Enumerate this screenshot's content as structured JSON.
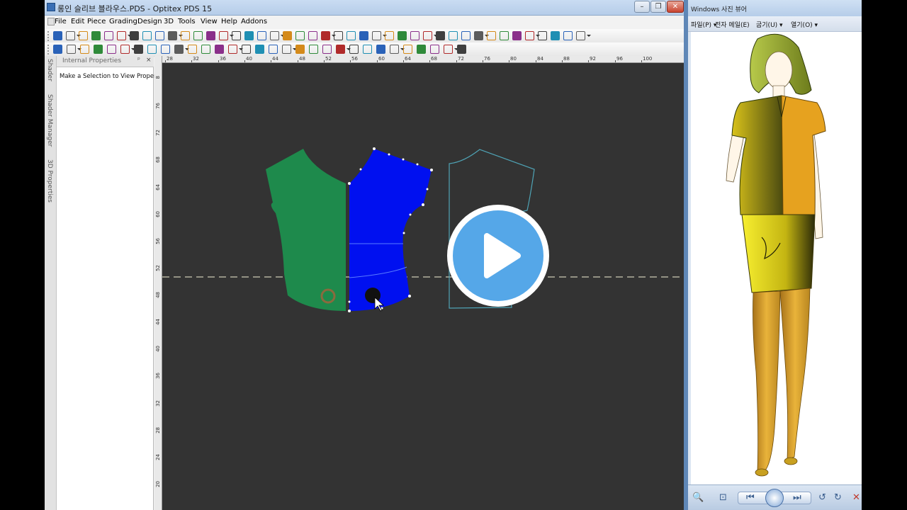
{
  "optitex": {
    "title": "롱인 슬리브 블라우스.PDS - Optitex PDS 15",
    "menu": [
      "File",
      "Edit",
      "Piece",
      "Grading",
      "Design",
      "3D",
      "Tools",
      "View",
      "Help",
      "Addons"
    ],
    "window_buttons": {
      "minimize": "–",
      "restore": "❐",
      "close": "✕"
    },
    "dock_tabs": [
      "Shader",
      "Shader Manager",
      "3D Properties"
    ],
    "panel": {
      "title": "Internal Properties",
      "pin": "ᵖ",
      "close": "×",
      "message": "Make a Selection to View Properties"
    },
    "hruler_labels": [
      "28",
      "32",
      "36",
      "40",
      "44",
      "48",
      "52",
      "56",
      "60",
      "64",
      "68",
      "72",
      "76",
      "80",
      "84",
      "88",
      "92",
      "96",
      "100"
    ],
    "vruler_labels": [
      "8",
      "76",
      "72",
      "68",
      "64",
      "60",
      "56",
      "52",
      "48",
      "44",
      "40",
      "36",
      "32",
      "28",
      "24",
      "20"
    ],
    "colors": {
      "canvas": "#333333",
      "front_piece": "#1e8a4c",
      "back_piece": "#0010f0",
      "outline_piece": "#4fa3b5",
      "play_button": "#55a7e8"
    }
  },
  "viewer": {
    "title": "Windows 사진 뷰어",
    "menu": [
      "파일(P) ▾",
      "전자 메일(E)",
      "굽기(U) ▾",
      "열기(O) ▾"
    ],
    "controls": [
      "🔍",
      "⊡",
      "⏮",
      "⏭",
      "↺",
      "↻",
      "✕"
    ]
  }
}
